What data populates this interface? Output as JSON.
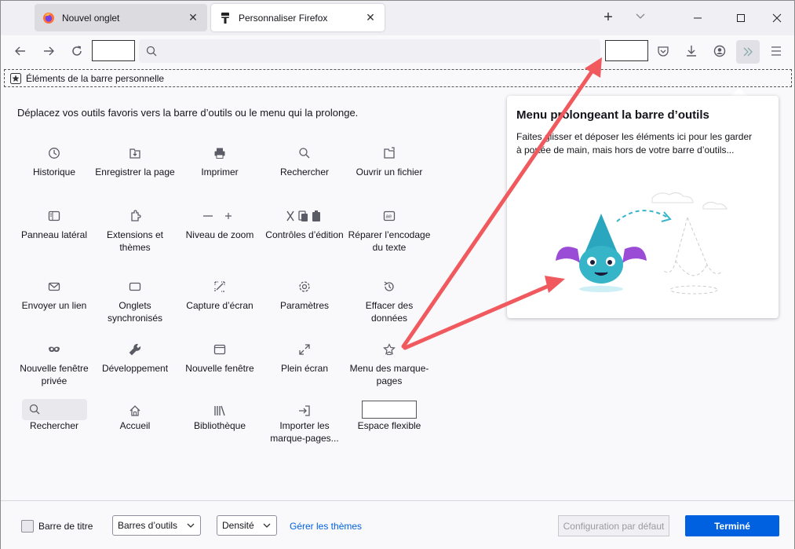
{
  "tabs": [
    {
      "title": "Nouvel onglet",
      "icon": "firefox-icon"
    },
    {
      "title": "Personnaliser Firefox",
      "icon": "paintbrush-icon"
    }
  ],
  "personal_toolbar": {
    "label": "Éléments de la barre personnelle"
  },
  "instructions": "Déplacez vos outils favoris vers la barre d’outils ou le menu qui la prolonge.",
  "palette": [
    {
      "label": "Historique",
      "icon": "history-icon"
    },
    {
      "label": "Enregistrer la page",
      "icon": "save-page-icon"
    },
    {
      "label": "Imprimer",
      "icon": "print-icon"
    },
    {
      "label": "Rechercher",
      "icon": "search-icon"
    },
    {
      "label": "Ouvrir un fichier",
      "icon": "open-file-icon"
    },
    {
      "label": "Panneau latéral",
      "icon": "sidebar-icon"
    },
    {
      "label": "Extensions et thèmes",
      "icon": "extensions-icon"
    },
    {
      "label": "Niveau de zoom",
      "icon": "zoom-icon"
    },
    {
      "label": "Contrôles d’édition",
      "icon": "edit-controls-icon"
    },
    {
      "label": "Réparer l’encodage du texte",
      "icon": "text-encoding-icon"
    },
    {
      "label": "Envoyer un lien",
      "icon": "email-link-icon"
    },
    {
      "label": "Onglets synchronisés",
      "icon": "synced-tabs-icon"
    },
    {
      "label": "Capture d’écran",
      "icon": "screenshot-icon"
    },
    {
      "label": "Paramètres",
      "icon": "gear-icon"
    },
    {
      "label": "Effacer des données",
      "icon": "forget-icon"
    },
    {
      "label": "Nouvelle fenêtre privée",
      "icon": "private-window-icon"
    },
    {
      "label": "Développement",
      "icon": "wrench-icon"
    },
    {
      "label": "Nouvelle fenêtre",
      "icon": "new-window-icon"
    },
    {
      "label": "Plein écran",
      "icon": "fullscreen-icon"
    },
    {
      "label": "Menu des marque-pages",
      "icon": "bookmarks-menu-icon"
    },
    {
      "label": "Rechercher",
      "icon": "search-icon"
    },
    {
      "label": "Accueil",
      "icon": "home-icon"
    },
    {
      "label": "Bibliothèque",
      "icon": "library-icon"
    },
    {
      "label": "Importer les marque-pages...",
      "icon": "import-icon"
    },
    {
      "label": "Espace flexible",
      "icon": "flexible-space-icon"
    }
  ],
  "overflow_panel": {
    "title": "Menu prolongeant la barre d’outils",
    "description": "Faites glisser et déposer les éléments ici pour les garder à portée de main, mais hors de votre barre d’outils..."
  },
  "footer": {
    "title_bar_label": "Barre de titre",
    "toolbars_select": "Barres d’outils",
    "density_select": "Densité",
    "themes_link": "Gérer les thèmes",
    "restore_defaults": "Configuration par défaut",
    "done": "Terminé"
  },
  "colors": {
    "accent": "#0061e0",
    "arrow": "#f05a5e",
    "mascot": "#36b5c9",
    "mascot_wings": "#9b4cd6"
  }
}
